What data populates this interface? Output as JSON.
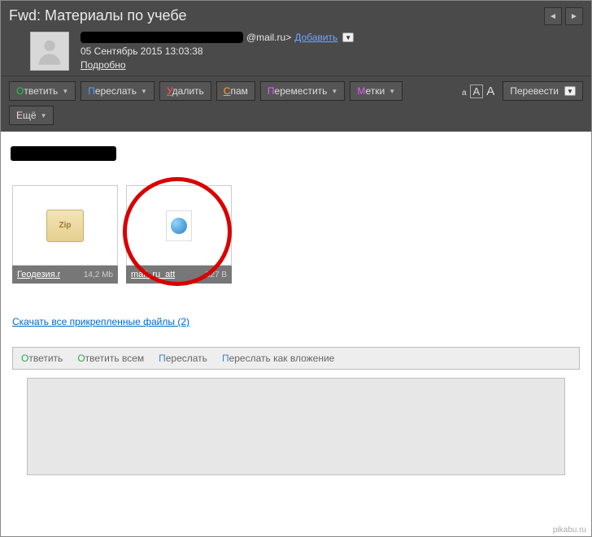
{
  "subject": "Fwd: Материалы по учебе",
  "sender": {
    "domain_suffix": "@mail.ru>",
    "add_label": "Добавить",
    "date": "05 Сентябрь 2015 13:03:38",
    "details_label": "Подробно"
  },
  "toolbar": {
    "reply": "Ответить",
    "forward": "Переслать",
    "delete": "Удалить",
    "spam": "Спам",
    "move": "Переместить",
    "labels": "Метки",
    "more": "Ещё",
    "translate": "Перевести",
    "font_a": "а",
    "font_b": "А",
    "font_c": "А"
  },
  "attachments": [
    {
      "name": "Геодезия.r",
      "size": "14,2 Mb",
      "icon": "zip"
    },
    {
      "name": "mail_ru_att",
      "size": "527 B",
      "icon": "globe"
    }
  ],
  "download_all": "Скачать все прикрепленные файлы (2)",
  "reply_bar": {
    "reply": "Ответить",
    "reply_all": "Ответить всем",
    "forward": "Переслать",
    "forward_attach": "Переслать как вложение"
  },
  "watermark": "pikabu.ru"
}
